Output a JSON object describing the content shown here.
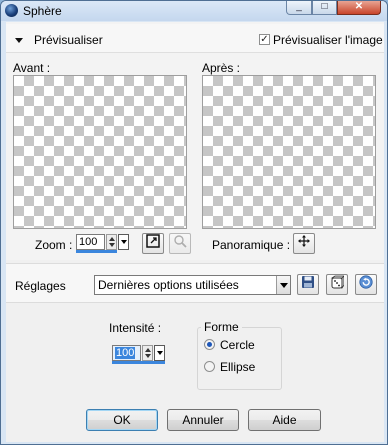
{
  "window": {
    "title": "Sphère",
    "minimize_glyph": "_",
    "maximize_glyph": "□",
    "close_glyph": "✕"
  },
  "preview_section": {
    "label": "Prévisualiser",
    "checkbox_label": "Prévisualiser l'image",
    "checkbox_checked": true,
    "check_glyph": "✓",
    "before_label": "Avant :",
    "after_label": "Après :",
    "zoom_label": "Zoom :",
    "zoom_value": "100",
    "pan_label": "Panoramique :"
  },
  "settings": {
    "label": "Réglages",
    "preset_value": "Dernières options utilisées"
  },
  "params": {
    "intensity_label": "Intensité :",
    "intensity_value": "100",
    "shape_group_label": "Forme",
    "shape_options": [
      {
        "label": "Cercle",
        "selected": true
      },
      {
        "label": "Ellipse",
        "selected": false
      }
    ]
  },
  "buttons": {
    "ok": "OK",
    "cancel": "Annuler",
    "help": "Aide"
  },
  "colors": {
    "title_bar": "#c4d7ee",
    "accent": "#3b86dd",
    "close_button": "#c9452b"
  },
  "icons": [
    "sphere-app-icon",
    "fit-to-window-icon",
    "magnifier-icon",
    "move-crosshair-icon",
    "save-preset-icon",
    "dice-random-icon",
    "reset-icon"
  ]
}
